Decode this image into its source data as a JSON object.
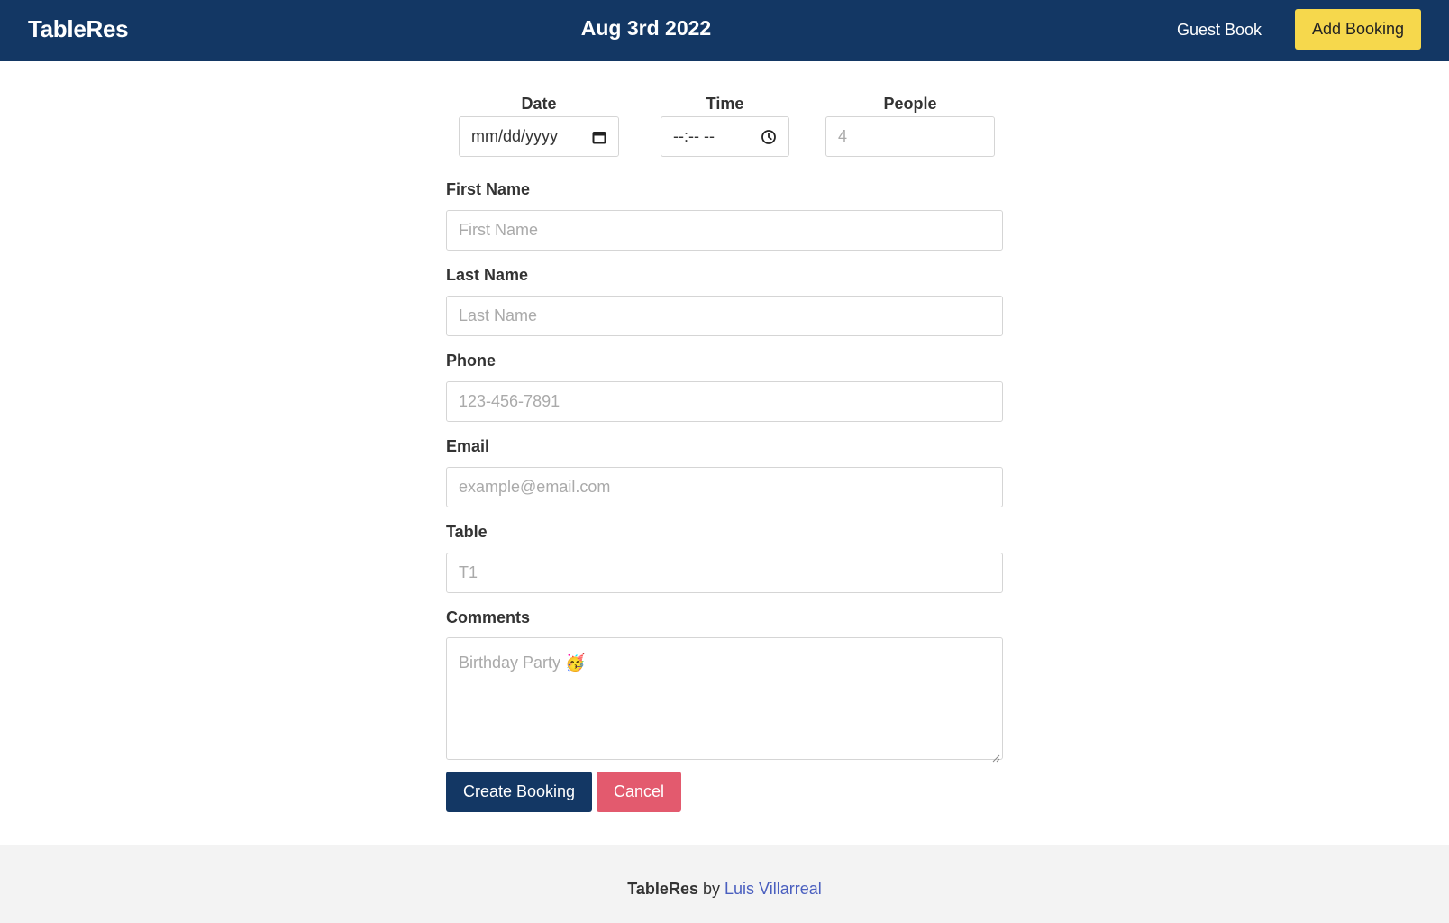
{
  "navbar": {
    "brand": "TableRes",
    "date": "Aug 3rd 2022",
    "guest_book": "Guest Book",
    "add_booking": "Add Booking",
    "background_color": "#133764",
    "accent_color": "#f6d84c"
  },
  "form": {
    "date": {
      "label": "Date",
      "value": "mm/dd/yyyy",
      "icon": "calendar-icon"
    },
    "time": {
      "label": "Time",
      "value": "--:-- --",
      "icon": "clock-icon"
    },
    "people": {
      "label": "People",
      "placeholder": "4"
    },
    "first_name": {
      "label": "First Name",
      "placeholder": "First Name"
    },
    "last_name": {
      "label": "Last Name",
      "placeholder": "Last Name"
    },
    "phone": {
      "label": "Phone",
      "placeholder": "123-456-7891"
    },
    "email": {
      "label": "Email",
      "placeholder": "example@email.com"
    },
    "table": {
      "label": "Table",
      "placeholder": "T1"
    },
    "comments": {
      "label": "Comments",
      "placeholder": "Birthday Party 🥳"
    },
    "create_button": "Create Booking",
    "cancel_button": "Cancel",
    "create_color": "#133764",
    "cancel_color": "#e35a6e"
  },
  "footer": {
    "brand": "TableRes",
    "by": "by",
    "author": "Luis Villarreal"
  }
}
